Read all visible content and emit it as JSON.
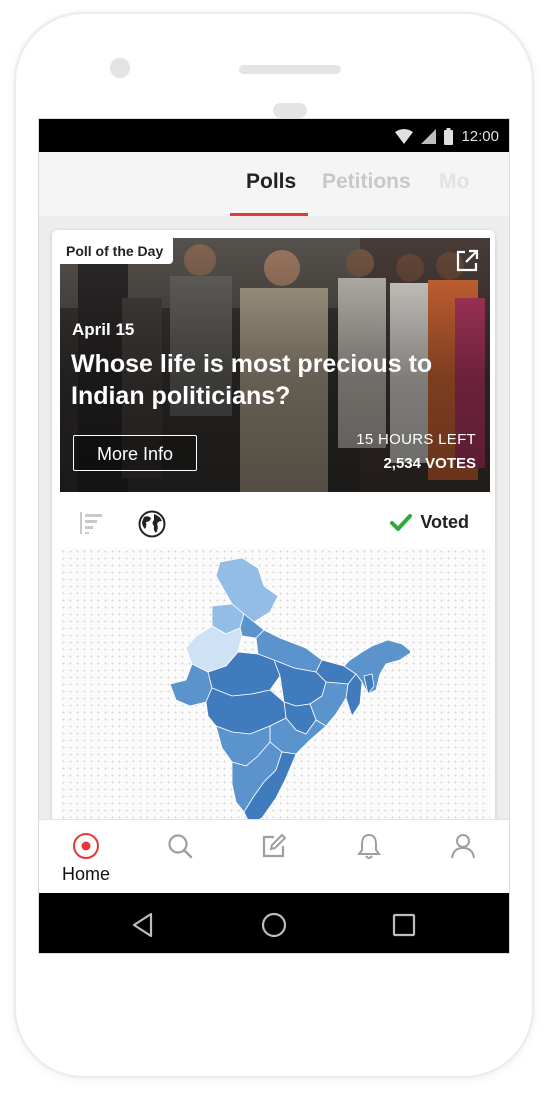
{
  "status_bar": {
    "time": "12:00"
  },
  "tabs": [
    {
      "label": "Polls",
      "active": true
    },
    {
      "label": "Petitions",
      "active": false
    },
    {
      "label": "Mo",
      "active": false
    }
  ],
  "poll_card": {
    "badge": "Poll of the Day",
    "date": "April 15",
    "question": "Whose life is most precious to Indian politicians?",
    "more_info_label": "More Info",
    "time_left": "15 HOURS LEFT",
    "votes": "2,534 VOTES",
    "voted_label": "Voted",
    "icons": [
      "external-link-icon",
      "bar-chart-icon",
      "globe-icon",
      "checkmark-icon"
    ]
  },
  "bottom_nav": [
    {
      "label": "Home",
      "icon": "home-record-icon",
      "active": true
    },
    {
      "label": "",
      "icon": "search-icon",
      "active": false
    },
    {
      "label": "",
      "icon": "compose-icon",
      "active": false
    },
    {
      "label": "",
      "icon": "bell-icon",
      "active": false
    },
    {
      "label": "",
      "icon": "profile-icon",
      "active": false
    }
  ],
  "system_nav": [
    "back-icon",
    "home-circle-icon",
    "recents-icon"
  ],
  "colors": {
    "accent": "#e53935",
    "check": "#2eaa3a",
    "map_dark": "#3f7bbd",
    "map_mid": "#5b93cc",
    "map_light": "#93bde6",
    "map_lightest": "#cfe2f5"
  }
}
